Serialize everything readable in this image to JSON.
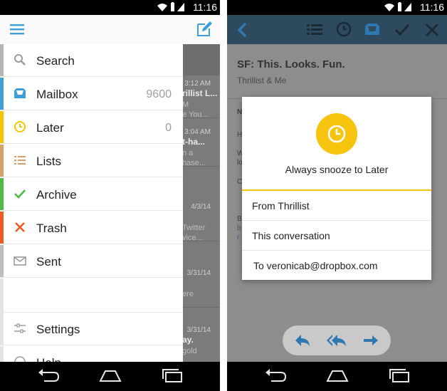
{
  "status": {
    "time": "11:16"
  },
  "left": {
    "drawer_items": [
      {
        "label": "Search",
        "count": "",
        "color": "#b5b5b5",
        "icon": "search-icon"
      },
      {
        "label": "Mailbox",
        "count": "9600",
        "color": "#3d9fd6",
        "icon": "mailbox-icon"
      },
      {
        "label": "Later",
        "count": "0",
        "color": "#f5c400",
        "icon": "clock-icon"
      },
      {
        "label": "Lists",
        "count": "",
        "color": "#d5a06a",
        "icon": "list-icon"
      },
      {
        "label": "Archive",
        "count": "",
        "color": "#4fb948",
        "icon": "check-icon"
      },
      {
        "label": "Trash",
        "count": "",
        "color": "#f05a22",
        "icon": "x-icon"
      },
      {
        "label": "Sent",
        "count": "",
        "color": "#bdbdbd",
        "icon": "envelope-icon"
      }
    ],
    "settings_label": "Settings",
    "help_label": "Help",
    "bg_rows": [
      {
        "time": "3:12 AM",
        "from": "rillist L...",
        "s1": "M",
        "s2": "e You..."
      },
      {
        "time": "3:04 AM",
        "from": "t-ha...",
        "s1": "n a",
        "s2": "hase..."
      },
      {
        "time": "4/3/14",
        "from": "",
        "s1": "Twitter",
        "s2": "vice..."
      },
      {
        "time": "3/31/14",
        "from": "",
        "s1": "ere",
        "s2": ""
      },
      {
        "time": "3/31/14",
        "from": "ay.",
        "s1": "gold",
        "s2": ""
      }
    ]
  },
  "right": {
    "mail_title": "SF: This. Looks. Fun.",
    "mail_sub": "Thrillist & Me",
    "dialog": {
      "title": "Always snooze to Later",
      "options": [
        "From Thrillist",
        "This conversation",
        "To veronicab@dropbox.com"
      ]
    },
    "peek": [
      "N",
      "H",
      "W",
      "lo",
      "C",
      "B",
      "b",
      "r"
    ]
  }
}
